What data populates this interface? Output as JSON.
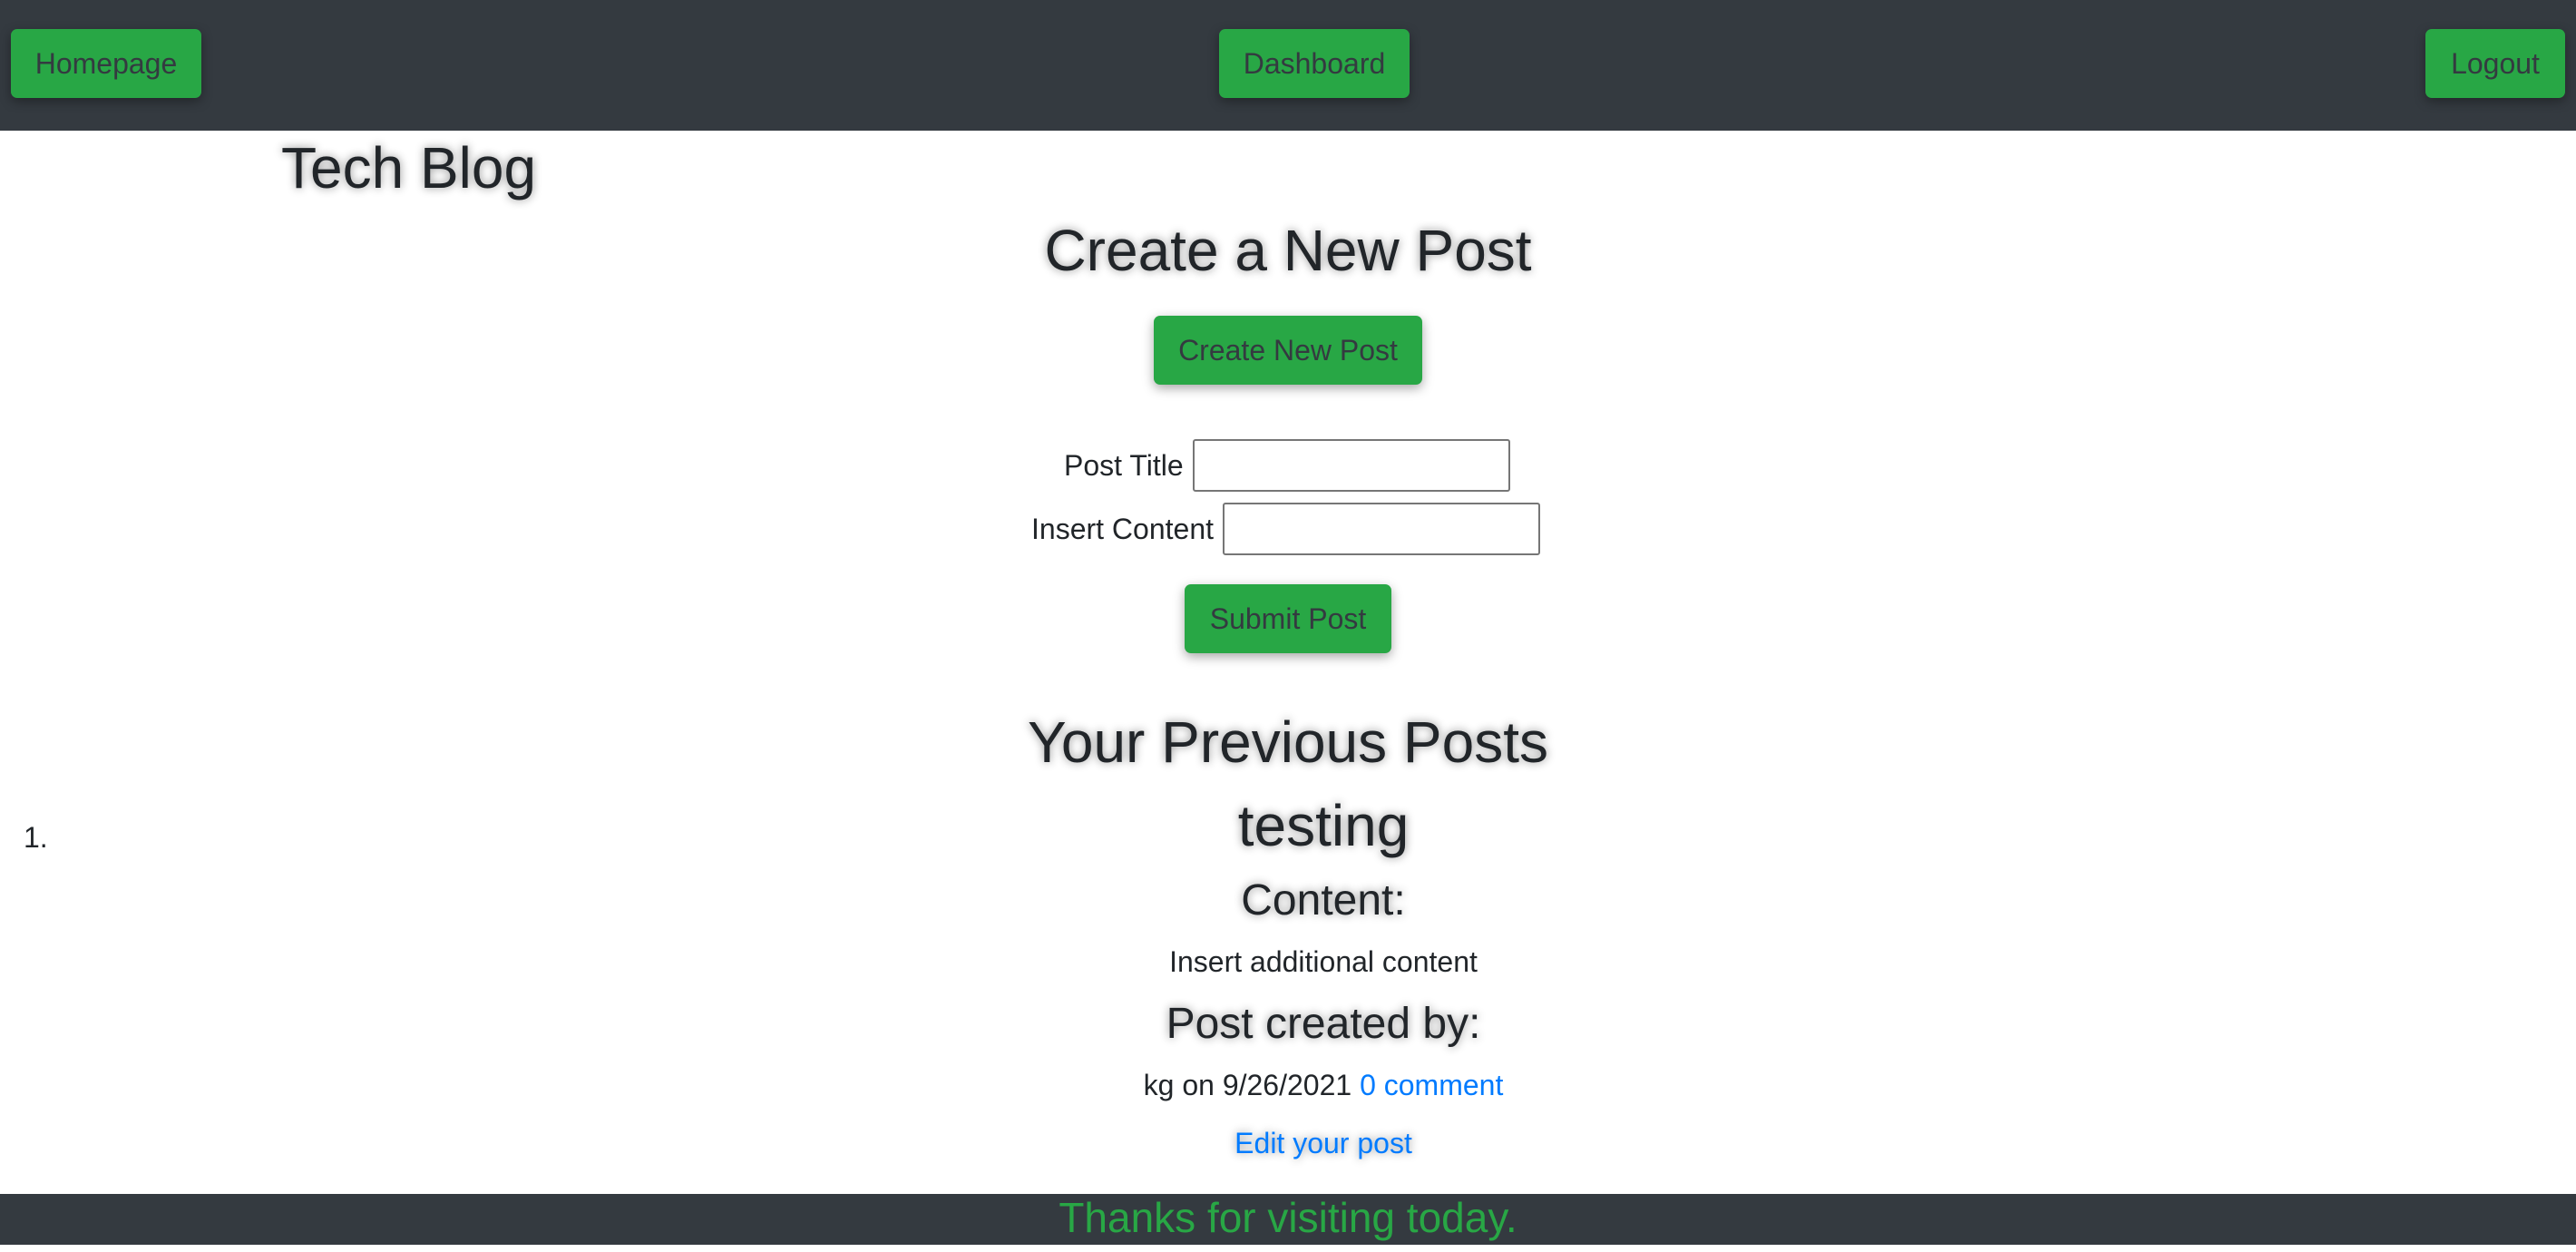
{
  "nav": {
    "homepage_label": "Homepage",
    "dashboard_label": "Dashboard",
    "logout_label": "Logout"
  },
  "brand": "Tech Blog",
  "create": {
    "heading": "Create a New Post",
    "button_label": "Create New Post",
    "title_label": "Post Title",
    "title_value": "",
    "content_label": "Insert Content",
    "content_value": "",
    "submit_label": "Submit Post"
  },
  "previous": {
    "heading": "Your Previous Posts",
    "posts": [
      {
        "number": "1.",
        "title": "testing",
        "content_heading": "Content:",
        "content": "Insert additional content",
        "created_by_heading": "Post created by:",
        "author_date": "kg on 9/26/2021",
        "comments_link": "0 comment",
        "edit_link": "Edit your post"
      }
    ]
  },
  "footer": {
    "text": "Thanks for visiting today."
  },
  "colors": {
    "navbar": "#343a40",
    "button": "#28a745",
    "link": "#007bff",
    "footer_text": "#28a745"
  }
}
